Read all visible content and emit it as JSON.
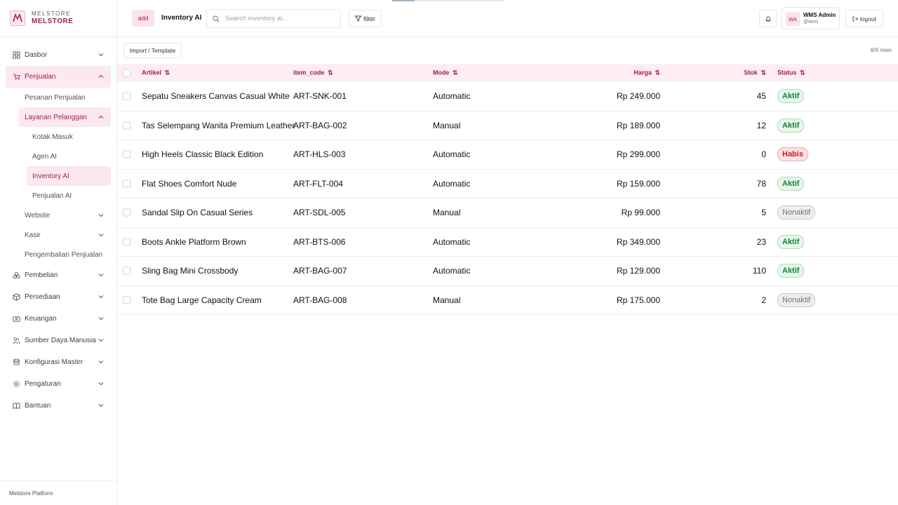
{
  "brand": {
    "top": "MELSTORE",
    "name": "MELSTORE"
  },
  "sidebar": {
    "items": [
      {
        "label": "Dasbor"
      },
      {
        "label": "Penjualan"
      },
      {
        "label": "Pesanan Penjualan"
      },
      {
        "label": "Layanan Pelanggan"
      },
      {
        "label": "Kotak Masuk"
      },
      {
        "label": "Agen AI"
      },
      {
        "label": "Inventory AI"
      },
      {
        "label": "Penjualan AI"
      },
      {
        "label": "Website"
      },
      {
        "label": "Kasir"
      },
      {
        "label": "Pengembalian Penjualan"
      },
      {
        "label": "Pembelian"
      },
      {
        "label": "Persediaan"
      },
      {
        "label": "Keuangan"
      },
      {
        "label": "Sumber Daya Manusia"
      },
      {
        "label": "Konfigurasi Master"
      },
      {
        "label": "Pengaturan"
      },
      {
        "label": "Bantuan"
      }
    ],
    "footer": "Melstore Platform"
  },
  "header": {
    "add_label": "add",
    "title": "Inventory AI",
    "search_placeholder": "Search inventory ai...",
    "filter_label": "filter",
    "user": {
      "initials": "WA",
      "name": "WMS Admin",
      "handle": "@wms"
    },
    "logout_label": "logout",
    "loading_progress": 0.2
  },
  "toolbar": {
    "import_label": "Import / Template",
    "row_count": "8/9 rows"
  },
  "table": {
    "columns": [
      "Artikel",
      "item_code",
      "Mode",
      "Harga",
      "Stok",
      "Status"
    ],
    "sort_glyph": "⇅",
    "rows": [
      {
        "artikel": "Sepatu Sneakers Canvas Casual White",
        "code": "ART-SNK-001",
        "mode": "Automatic",
        "harga": "Rp 249.000",
        "stok": "45",
        "status": "Aktif",
        "status_kind": "aktif"
      },
      {
        "artikel": "Tas Selempang Wanita Premium Leather",
        "code": "ART-BAG-002",
        "mode": "Manual",
        "harga": "Rp 189.000",
        "stok": "12",
        "status": "Aktif",
        "status_kind": "aktif"
      },
      {
        "artikel": "High Heels Classic Black Edition",
        "code": "ART-HLS-003",
        "mode": "Automatic",
        "harga": "Rp 299.000",
        "stok": "0",
        "status": "Habis",
        "status_kind": "habis"
      },
      {
        "artikel": "Flat Shoes Comfort Nude",
        "code": "ART-FLT-004",
        "mode": "Automatic",
        "harga": "Rp 159.000",
        "stok": "78",
        "status": "Aktif",
        "status_kind": "aktif"
      },
      {
        "artikel": "Sandal Slip On Casual Series",
        "code": "ART-SDL-005",
        "mode": "Manual",
        "harga": "Rp 99.000",
        "stok": "5",
        "status": "Nonaktif",
        "status_kind": "nonaktif"
      },
      {
        "artikel": "Boots Ankle Platform Brown",
        "code": "ART-BTS-006",
        "mode": "Automatic",
        "harga": "Rp 349.000",
        "stok": "23",
        "status": "Aktif",
        "status_kind": "aktif"
      },
      {
        "artikel": "Sling Bag Mini Crossbody",
        "code": "ART-BAG-007",
        "mode": "Automatic",
        "harga": "Rp 129.000",
        "stok": "110",
        "status": "Aktif",
        "status_kind": "aktif"
      },
      {
        "artikel": "Tote Bag Large Capacity Cream",
        "code": "ART-BAG-008",
        "mode": "Manual",
        "harga": "Rp 175.000",
        "stok": "2",
        "status": "Nonaktif",
        "status_kind": "nonaktif"
      }
    ]
  },
  "colors": {
    "accent": "#a3204d",
    "accent_bg": "#fce8ef",
    "header_bg": "#fdeef3"
  }
}
